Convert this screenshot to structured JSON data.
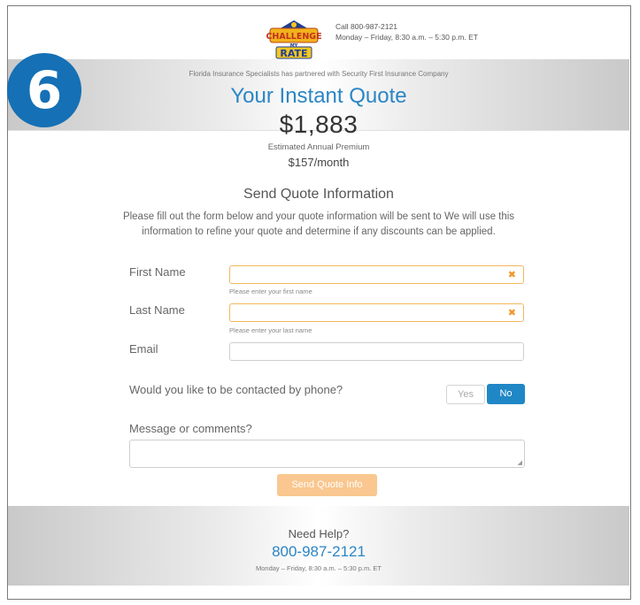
{
  "header": {
    "logo_text": "CHALLENGE MY RATE",
    "phone_line": "Call 800-987-2121",
    "hours_line": "Monday – Friday, 8:30 a.m. – 5:30 p.m. ET"
  },
  "step_badge": "6",
  "quote": {
    "partner_text": "Florida Insurance Specialists has partnered with Security First Insurance Company",
    "title": "Your Instant Quote",
    "amount": "$1,883",
    "amount_label": "Estimated Annual Premium",
    "monthly": "$157/month"
  },
  "form": {
    "title": "Send Quote Information",
    "description": "Please fill out the form below and your quote information will be sent to        We will use this information to refine your quote and determine if any discounts can be applied.",
    "first_name_label": "First Name",
    "first_name_value": "",
    "first_name_hint": "Please enter your first name",
    "last_name_label": "Last Name",
    "last_name_value": "",
    "last_name_hint": "Please enter your last name",
    "email_label": "Email",
    "email_value": "",
    "phone_question": "Would you like to be contacted by phone?",
    "yes_label": "Yes",
    "no_label": "No",
    "message_label": "Message or comments?",
    "message_value": "",
    "submit_label": "Send Quote Info"
  },
  "footer": {
    "help_title": "Need Help?",
    "help_phone": "800-987-2121",
    "help_hours": "Monday – Friday, 8:30 a.m. – 5:30 p.m. ET"
  },
  "colors": {
    "accent_blue": "#2b86c5",
    "button_blue": "#2087c6",
    "submit_orange": "#f9c78f",
    "error_orange": "#f0962a"
  }
}
